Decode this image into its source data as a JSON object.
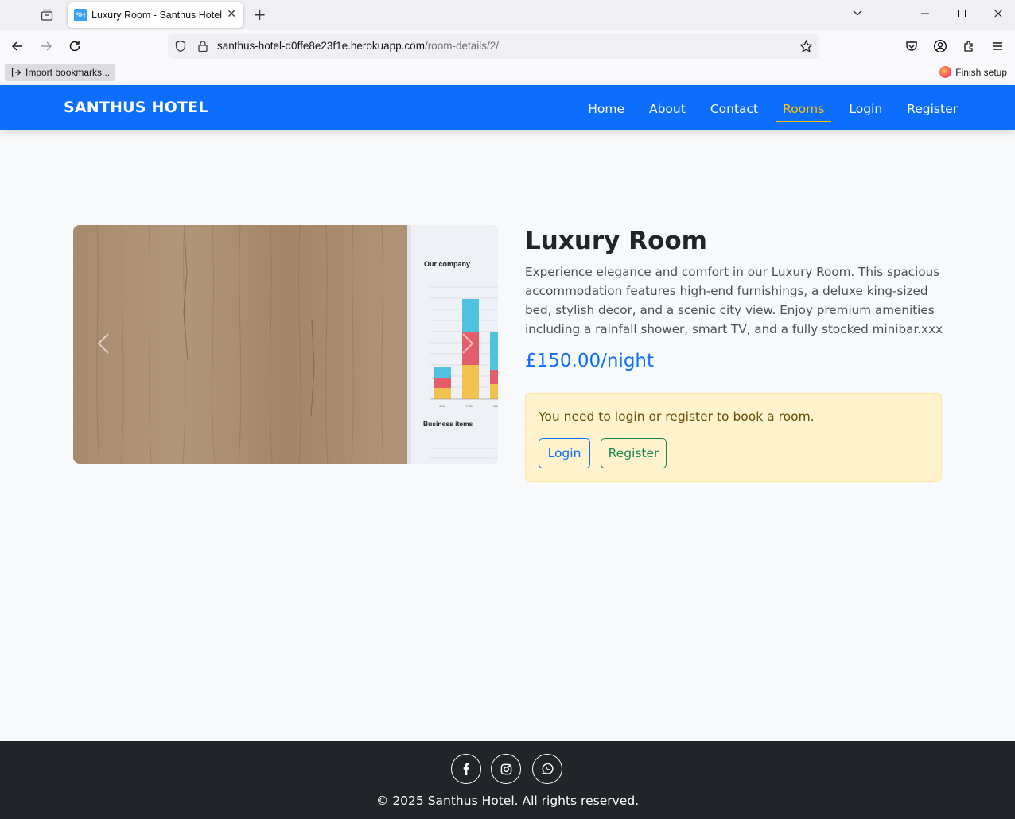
{
  "browser": {
    "tab_title": "Luxury Room - Santhus Hotel",
    "favicon_text": "SH",
    "url_host": "santhus-hotel-d0ffe8e23f1e.herokuapp.com",
    "url_path": "/room-details/2/",
    "bookmark_import": "Import bookmarks...",
    "finish_setup": "Finish setup"
  },
  "nav": {
    "brand": "SANTHUS HOTEL",
    "links": [
      "Home",
      "About",
      "Contact",
      "Rooms",
      "Login",
      "Register"
    ],
    "active": "Rooms",
    "active_color": "#ffc107",
    "background": "#0d6efd"
  },
  "room": {
    "title": "Luxury Room",
    "description": "Experience elegance and comfort in our Luxury Room. This spacious accommodation features high-end furnishings, a deluxe king-sized bed, stylish decor, and a scenic city view. Enjoy premium amenities including a rainfall shower, smart TV, and a fully stocked minibar.xxx",
    "price": "£150.00/night",
    "image": {
      "heading": "Our company",
      "subheading": "Business items",
      "month_labels": [
        "JAN",
        "FEB",
        "MA"
      ]
    }
  },
  "booking": {
    "notice": "You need to login or register to book a room.",
    "login_label": "Login",
    "register_label": "Register"
  },
  "footer": {
    "social_icons": [
      "facebook-icon",
      "instagram-icon",
      "whatsapp-icon"
    ],
    "copyright": "© 2025 Santhus Hotel. All rights reserved."
  }
}
